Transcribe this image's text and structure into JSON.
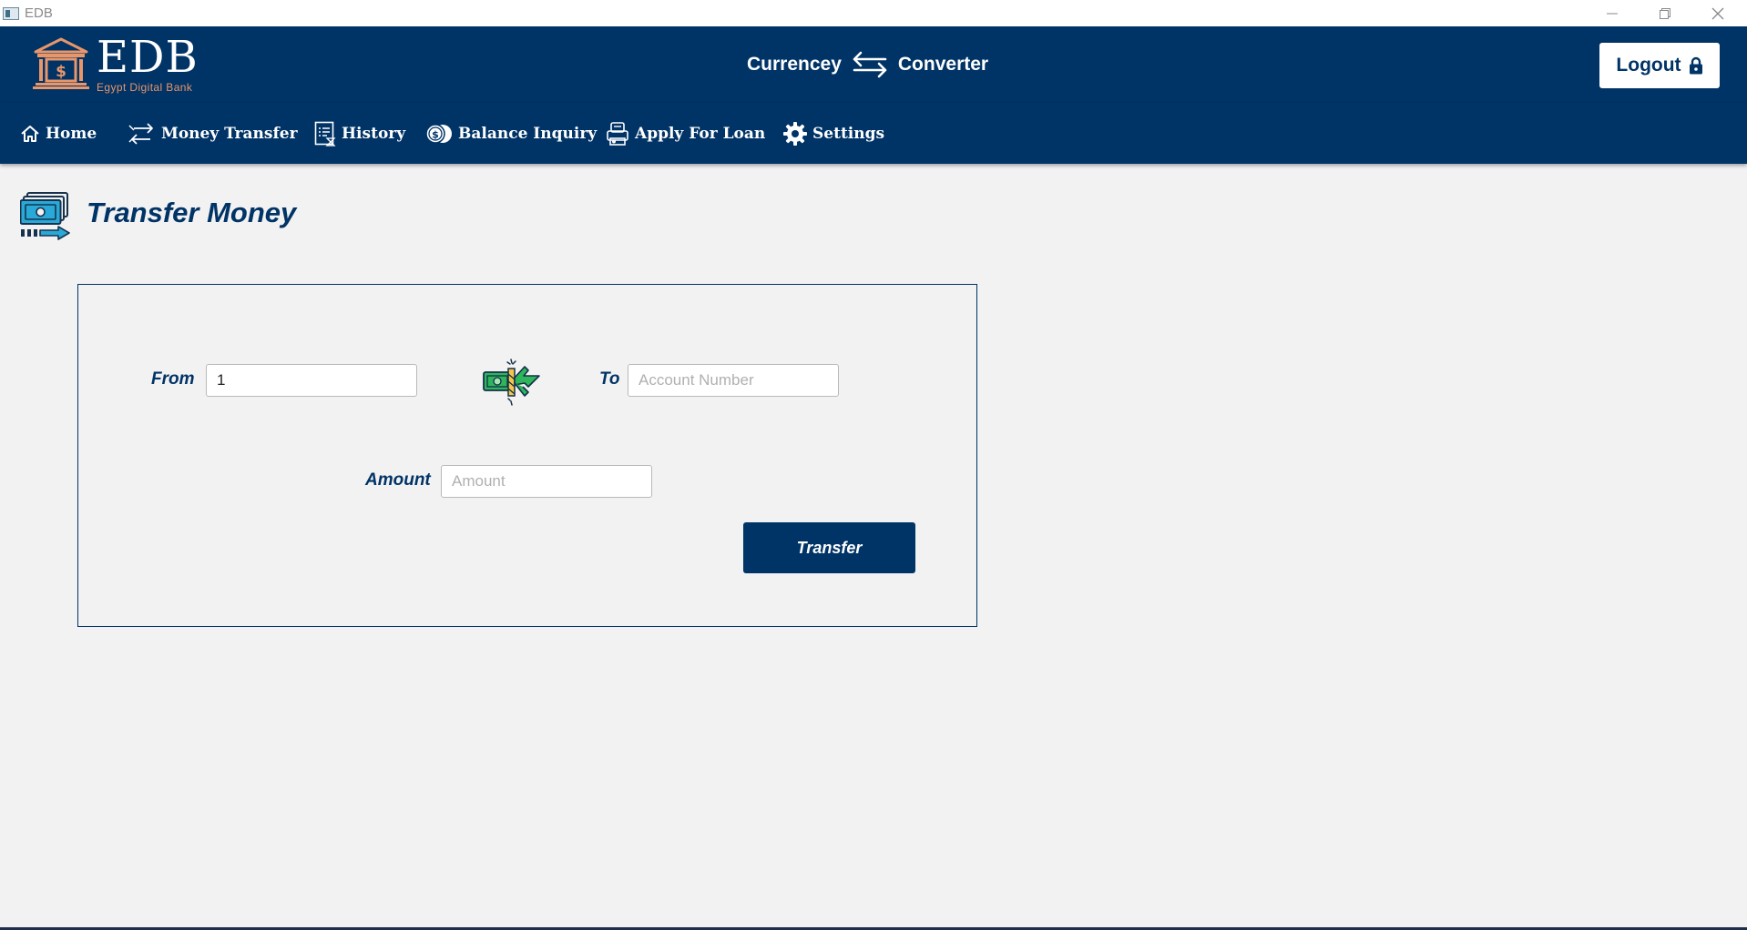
{
  "window": {
    "title": "EDB"
  },
  "header": {
    "logo_text": "EDB",
    "logo_subtitle": "Egypt Digital Bank",
    "currency_left": "Currencey",
    "currency_right": "Converter",
    "logout_label": "Logout"
  },
  "nav": {
    "items": [
      {
        "label": "Home",
        "icon": "home-icon"
      },
      {
        "label": "Money Transfer",
        "icon": "transfer-arrows-icon"
      },
      {
        "label": "History",
        "icon": "history-icon"
      },
      {
        "label": "Balance Inquiry",
        "icon": "coins-icon"
      },
      {
        "label": "Apply For Loan",
        "icon": "loan-icon"
      },
      {
        "label": "Settings",
        "icon": "gear-icon"
      }
    ]
  },
  "page": {
    "title": "Transfer Money"
  },
  "form": {
    "from_label": "From",
    "from_value": "1",
    "to_label": "To",
    "to_placeholder": "Account Number",
    "amount_label": "Amount",
    "amount_placeholder": "Amount",
    "transfer_label": "Transfer"
  },
  "colors": {
    "primary": "#003366",
    "background": "#f2f2f2",
    "logo_accent": "#e8966a"
  }
}
